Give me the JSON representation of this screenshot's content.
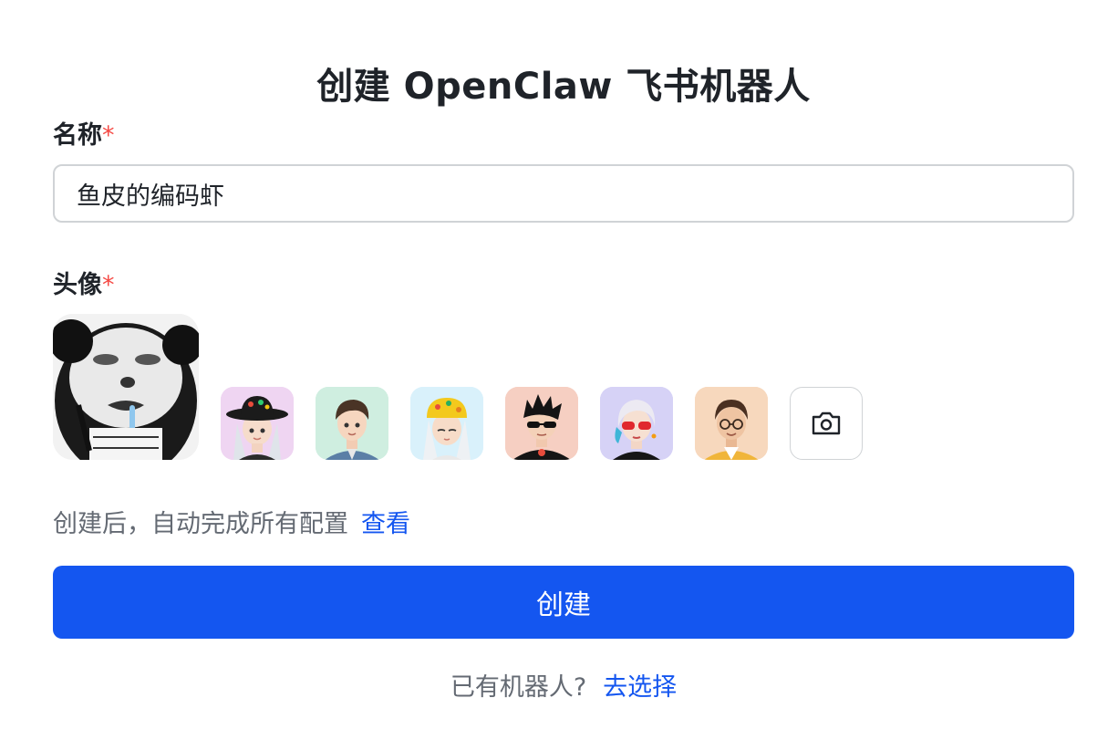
{
  "header": {
    "title": "创建 OpenClaw 飞书机器人"
  },
  "form": {
    "name_label": "名称",
    "name_required_mark": "*",
    "name_value": "鱼皮的编码虾",
    "avatar_label": "头像",
    "avatar_required_mark": "*"
  },
  "avatars": {
    "selected": "panda-meme-avatar",
    "options": [
      {
        "icon": "girl-black-hat-avatar",
        "bg": "#efd5f2"
      },
      {
        "icon": "boy-denim-avatar",
        "bg": "#cfeee0"
      },
      {
        "icon": "girl-yellow-hat-avatar",
        "bg": "#d9f1fb"
      },
      {
        "icon": "boy-sunglasses-avatar",
        "bg": "#f6cfc2"
      },
      {
        "icon": "girl-red-glasses-avatar",
        "bg": "#d6d2f6"
      },
      {
        "icon": "boy-glasses-avatar",
        "bg": "#f7d8bd"
      }
    ],
    "upload_icon": "camera-icon"
  },
  "hint": {
    "text": "创建后，自动完成所有配置",
    "link": "查看"
  },
  "actions": {
    "create_label": "创建"
  },
  "footer": {
    "text": "已有机器人?",
    "link": "去选择"
  },
  "colors": {
    "primary": "#1456f0",
    "required": "#f54a45",
    "muted": "#646a73"
  }
}
